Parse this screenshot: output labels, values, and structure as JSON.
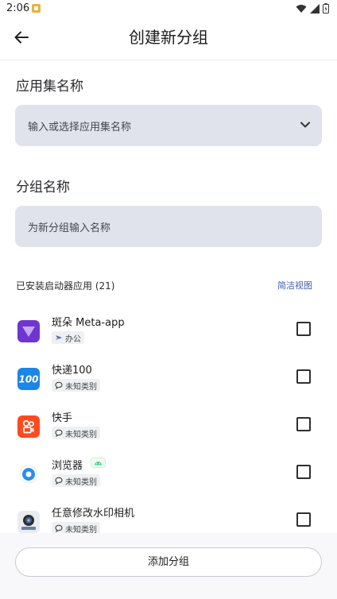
{
  "status_bar": {
    "time": "2:06"
  },
  "app_bar": {
    "title": "创建新分组"
  },
  "app_set": {
    "label": "应用集名称",
    "placeholder": "输入或选择应用集名称"
  },
  "group": {
    "label": "分组名称",
    "placeholder": "为新分组输入名称"
  },
  "apps_section": {
    "header": "已安装启动器应用 (21)",
    "simple_view_label": "简洁视图"
  },
  "apps": [
    {
      "name": "斑朵 Meta-app",
      "tag": "办公",
      "tag_icon": "plane-icon",
      "checked": false
    },
    {
      "name": "快递100",
      "tag": "未知类别",
      "tag_icon": "chat-bubble-icon",
      "checked": false
    },
    {
      "name": "快手",
      "tag": "未知类别",
      "tag_icon": "chat-bubble-icon",
      "checked": false
    },
    {
      "name": "浏览器",
      "tag": "未知类别",
      "tag_icon": "chat-bubble-icon",
      "checked": false,
      "badge_icon": "android-icon"
    },
    {
      "name": "任意修改水印相机",
      "tag": "未知类别",
      "tag_icon": "chat-bubble-icon",
      "checked": false
    }
  ],
  "bottom": {
    "add_button_label": "添加分组"
  },
  "colors": {
    "field_bg": "#e1e3ec",
    "link": "#3a5fb0",
    "kuaishou": "#fe4a1f",
    "kuaidi": "#1a86e8",
    "meta_purple": "#7b3fd8"
  }
}
